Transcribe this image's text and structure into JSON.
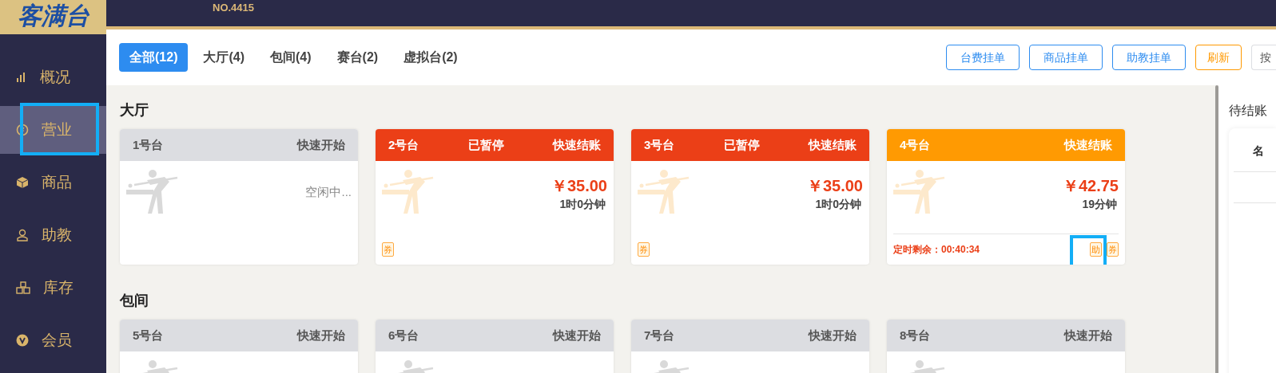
{
  "logo": {
    "text": "客满台"
  },
  "header": {
    "store_no": "NO.4415"
  },
  "sidebar": {
    "items": [
      {
        "label": "概况",
        "selected": false,
        "highlighted": false
      },
      {
        "label": "营业",
        "selected": true,
        "highlighted": true
      },
      {
        "label": "商品",
        "selected": false,
        "highlighted": false
      },
      {
        "label": "助教",
        "selected": false,
        "highlighted": false
      },
      {
        "label": "库存",
        "selected": false,
        "highlighted": false
      },
      {
        "label": "会员",
        "selected": false,
        "highlighted": false
      }
    ]
  },
  "tabs": [
    {
      "label": "全部(12)",
      "selected": true
    },
    {
      "label": "大厅(4)",
      "selected": false
    },
    {
      "label": "包间(4)",
      "selected": false
    },
    {
      "label": "赛台(2)",
      "selected": false
    },
    {
      "label": "虚拟台(2)",
      "selected": false
    }
  ],
  "toolbar_buttons": [
    {
      "label": "台费挂单",
      "kind": "blue"
    },
    {
      "label": "商品挂单",
      "kind": "blue"
    },
    {
      "label": "助教挂单",
      "kind": "blue"
    },
    {
      "label": "刷新",
      "kind": "orange"
    },
    {
      "label": "按",
      "kind": "plain"
    }
  ],
  "sections": [
    {
      "title": "大厅",
      "tables": [
        {
          "name": "1号台",
          "kind": "idle",
          "action": "快速开始",
          "idle_text": "空闲中..."
        },
        {
          "name": "2号台",
          "kind": "paused",
          "status_text": "已暂停",
          "action": "快速结账",
          "price": "￥35.00",
          "duration": "1时0分钟",
          "tags": [
            {
              "label": "券",
              "highlighted": false
            }
          ]
        },
        {
          "name": "3号台",
          "kind": "paused",
          "status_text": "已暂停",
          "action": "快速结账",
          "price": "￥35.00",
          "duration": "1时0分钟",
          "tags": [
            {
              "label": "券",
              "highlighted": false
            }
          ]
        },
        {
          "name": "4号台",
          "kind": "running",
          "action": "快速结账",
          "price": "￥42.75",
          "duration": "19分钟",
          "timer": "定时剩余：00:40:34",
          "tags": [
            {
              "label": "助",
              "highlighted": true
            },
            {
              "label": "券",
              "highlighted": false
            }
          ]
        }
      ]
    },
    {
      "title": "包间",
      "tables": [
        {
          "name": "5号台",
          "kind": "idle",
          "action": "快速开始"
        },
        {
          "name": "6号台",
          "kind": "idle",
          "action": "快速开始"
        },
        {
          "name": "7号台",
          "kind": "idle",
          "action": "快速开始"
        },
        {
          "name": "8号台",
          "kind": "idle",
          "action": "快速开始"
        }
      ]
    }
  ],
  "side_panel": {
    "title": "待结账",
    "column_1": "名"
  }
}
